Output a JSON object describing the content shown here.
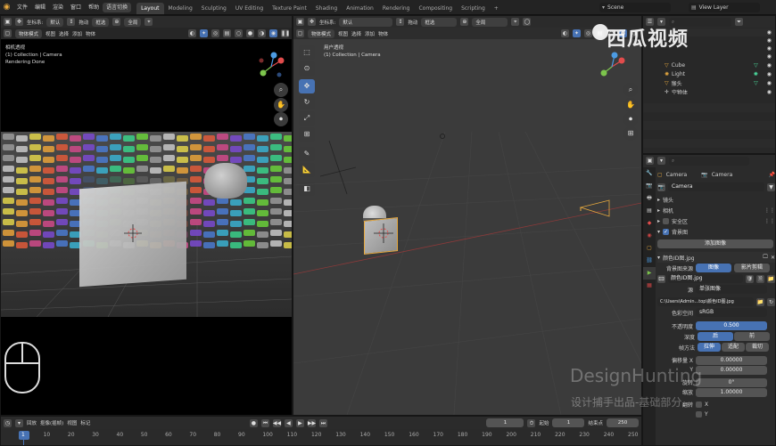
{
  "menus": {
    "file": "文件",
    "edit": "编辑",
    "render": "渲染",
    "window": "窗口",
    "help": "帮助"
  },
  "workspace_switch": "语言切换",
  "workspaces": [
    "Layout",
    "Modeling",
    "Sculpting",
    "UV Editing",
    "Texture Paint",
    "Shading",
    "Animation",
    "Rendering",
    "Compositing",
    "Scripting"
  ],
  "scene": "Scene",
  "view_layer": "View Layer",
  "header_common": {
    "coords_label": "坐标系:",
    "coords_value": "默认",
    "drag_label": "拖动",
    "select_mode": "框选",
    "pivot": "全局"
  },
  "left_viewport": {
    "mode": "物体模式",
    "menu_view": "视图",
    "menu_select": "选择",
    "menu_add": "添加",
    "menu_object": "物体",
    "overlay_title": "相机透视",
    "overlay_collection": "(1) Collection | Camera",
    "overlay_status": "Rendering Done"
  },
  "main_viewport": {
    "mode": "物体模式",
    "menu_view": "视图",
    "menu_select": "选择",
    "menu_add": "添加",
    "menu_object": "物体",
    "overlay_title": "用户透视",
    "overlay_collection": "(1) Collection | Camera"
  },
  "outliner": {
    "items": [
      {
        "label": "Cube",
        "color": "#3aa9ff"
      },
      {
        "label": "Light",
        "color": "#e7a93f"
      },
      {
        "label": "猴头",
        "color": "#e7a93f"
      },
      {
        "label": "空物体",
        "color": "#cfcfcf"
      }
    ]
  },
  "properties": {
    "tab_left": "Camera",
    "tab_right": "Camera",
    "datablock": "Camera",
    "sections": {
      "lens": "镜头",
      "camera": "相机",
      "safe_areas": "安全区",
      "background_images": "背景图"
    },
    "add_image": "添加图像",
    "image_title": "颜色ID图.jpg",
    "source_label": "背景图来源",
    "source_image": "图像",
    "source_movie": "影片剪辑",
    "image_name": "颜色ID图.jpg",
    "source_type_label": "源",
    "source_type_value": "单张图像",
    "filepath": "C:\\Users\\Admin...top\\颜色ID图.jpg",
    "colorspace_label": "色彩空间",
    "colorspace_value": "sRGB",
    "opacity_label": "不透明度",
    "opacity_value": "0.500",
    "depth_label": "深度",
    "depth_back": "后",
    "depth_front": "前",
    "fit_label": "帧方法",
    "fit_stretch": "拉伸",
    "fit_fit": "适配",
    "fit_crop": "裁切",
    "offset_label": "偏移量 X",
    "offset_x": "0.00000",
    "y_label": "Y",
    "offset_y": "0.00000",
    "rotation_label": "旋转",
    "rotation_value": "0°",
    "scale_label": "缩放",
    "scale_value": "1.00000",
    "flip_label": "翻转",
    "flip_x": "X",
    "flip_y": "Y"
  },
  "timeline": {
    "menu_playback": "回放",
    "menu_keying": "抠像(插帧)",
    "menu_view": "视图",
    "menu_marker": "标记",
    "current_frame": "1",
    "start_label": "起始",
    "start_value": "1",
    "end_label": "结束点",
    "end_value": "250",
    "ruler": [
      "1",
      "10",
      "20",
      "30",
      "40",
      "50",
      "60",
      "70",
      "80",
      "90",
      "100",
      "110",
      "120",
      "130",
      "140",
      "150",
      "160",
      "170",
      "180",
      "190",
      "200",
      "210",
      "220",
      "230",
      "240",
      "250"
    ]
  },
  "watermark": {
    "logo": "西瓜视频",
    "design": "DesignHunting",
    "slogan": "设计捕手出品-基础部分"
  },
  "colors": {
    "accent": "#4772b3",
    "panel": "#303030",
    "header": "#2b2b2b",
    "outline": "#e7a93f"
  }
}
